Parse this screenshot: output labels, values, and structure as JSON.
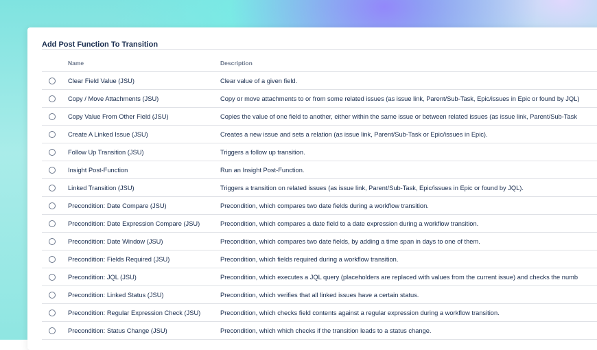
{
  "dialog": {
    "title": "Add Post Function To Transition"
  },
  "table": {
    "headers": {
      "name": "Name",
      "description": "Description"
    },
    "rows": [
      {
        "name": "Clear Field Value (JSU)",
        "description": "Clear value of a given field."
      },
      {
        "name": "Copy / Move Attachments (JSU)",
        "description": "Copy or move attachments to or from some related issues (as issue link, Parent/Sub-Task, Epic/issues in Epic or found by JQL)"
      },
      {
        "name": "Copy Value From Other Field (JSU)",
        "description": "Copies the value of one field to another, either within the same issue or between related issues (as issue link, Parent/Sub-Task"
      },
      {
        "name": "Create A Linked Issue (JSU)",
        "description": "Creates a new issue and sets a relation (as issue link, Parent/Sub-Task or Epic/issues in Epic)."
      },
      {
        "name": "Follow Up Transition (JSU)",
        "description": "Triggers a follow up transition."
      },
      {
        "name": "Insight Post-Function",
        "description": "Run an Insight Post-Function."
      },
      {
        "name": "Linked Transition (JSU)",
        "description": "Triggers a transition on related issues (as issue link, Parent/Sub-Task, Epic/issues in Epic or found by JQL)."
      },
      {
        "name": "Precondition: Date Compare (JSU)",
        "description": "Precondition, which compares two date fields during a workflow transition."
      },
      {
        "name": "Precondition: Date Expression Compare (JSU)",
        "description": "Precondition, which compares a date field to a date expression during a workflow transition."
      },
      {
        "name": "Precondition: Date Window (JSU)",
        "description": "Precondition, which compares two date fields, by adding a time span in days to one of them."
      },
      {
        "name": "Precondition: Fields Required (JSU)",
        "description": "Precondition, which fields required during a workflow transition."
      },
      {
        "name": "Precondition: JQL (JSU)",
        "description": "Precondition, which executes a JQL query (placeholders are replaced with values from the current issue) and checks the numb"
      },
      {
        "name": "Precondition: Linked Status (JSU)",
        "description": "Precondition, which verifies that all linked issues have a certain status."
      },
      {
        "name": "Precondition: Regular Expression Check (JSU)",
        "description": "Precondition, which checks field contents against a regular expression during a workflow transition."
      },
      {
        "name": "Precondition: Status Change (JSU)",
        "description": "Precondition, which which checks if the transition leads to a status change."
      }
    ]
  }
}
